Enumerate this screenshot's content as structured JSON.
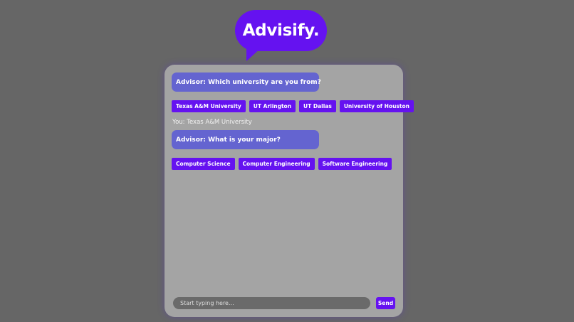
{
  "app": {
    "logo_text": "Advisify."
  },
  "chat": {
    "messages": [
      {
        "sender": "advisor",
        "text": "Advisor: Which university are you from?",
        "options": [
          "Texas A&M University",
          "UT Arlington",
          "UT Dallas",
          "University of Houston"
        ]
      },
      {
        "sender": "user",
        "text": "You: Texas A&M University"
      },
      {
        "sender": "advisor",
        "text": "Advisor: What is your major?",
        "options": [
          "Computer Science",
          "Computer Engineering",
          "Software Engineering"
        ]
      }
    ]
  },
  "composer": {
    "placeholder": "Start typing here...",
    "value": "",
    "send_label": "Send"
  },
  "colors": {
    "background": "#666666",
    "panel": "#a4a4a4",
    "accent": "#6512f0",
    "advisor_bubble": "#6464d0",
    "input": "#6a6a6a"
  }
}
